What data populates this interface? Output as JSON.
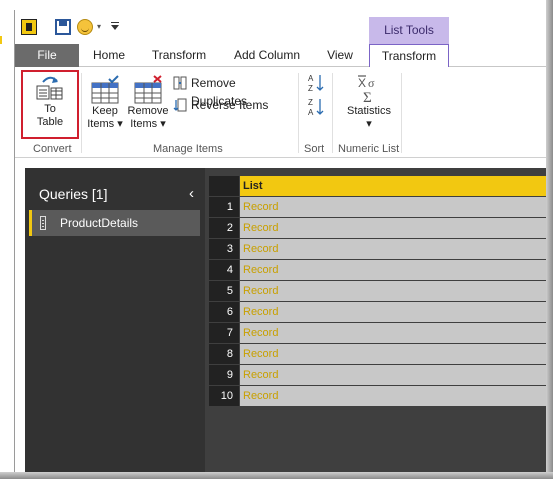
{
  "ribbon_tabs": {
    "context_group": "List Tools",
    "file": "File",
    "home": "Home",
    "transform": "Transform",
    "add_column": "Add Column",
    "view": "View",
    "context_transform": "Transform"
  },
  "ribbon": {
    "to_table": {
      "line1": "To",
      "line2": "Table"
    },
    "keep_items": {
      "line1": "Keep",
      "line2": "Items"
    },
    "remove_items": {
      "line1": "Remove",
      "line2": "Items"
    },
    "remove_duplicates": "Remove Duplicates",
    "reverse_items": "Reverse Items",
    "statistics": "Statistics",
    "groups": {
      "convert": "Convert",
      "manage_items": "Manage Items",
      "sort": "Sort",
      "numeric_list": "Numeric List"
    },
    "sort_asc_label": "A↓Z",
    "sort_desc_label": "Z↓A",
    "stats_symbol": "X̄σ",
    "stats_sigma": "Σ"
  },
  "queries": {
    "title": "Queries [1]",
    "items": [
      {
        "label": "ProductDetails"
      }
    ]
  },
  "grid": {
    "column_header": "List",
    "rows": [
      {
        "num": "1",
        "value": "Record"
      },
      {
        "num": "2",
        "value": "Record"
      },
      {
        "num": "3",
        "value": "Record"
      },
      {
        "num": "4",
        "value": "Record"
      },
      {
        "num": "5",
        "value": "Record"
      },
      {
        "num": "6",
        "value": "Record"
      },
      {
        "num": "7",
        "value": "Record"
      },
      {
        "num": "8",
        "value": "Record"
      },
      {
        "num": "9",
        "value": "Record"
      },
      {
        "num": "10",
        "value": "Record"
      }
    ]
  },
  "colors": {
    "accent_yellow": "#f2c811",
    "highlight_red": "#d01f2e",
    "context_purple": "#c8b9ea",
    "record_text": "#c8a000"
  }
}
